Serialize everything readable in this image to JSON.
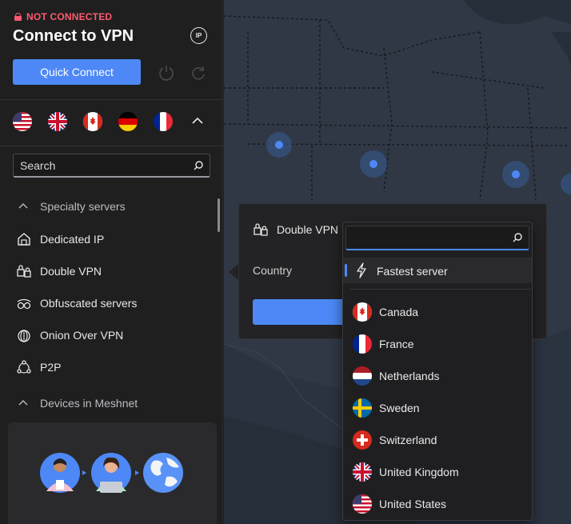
{
  "sidebar": {
    "status": "NOT CONNECTED",
    "title": "Connect to VPN",
    "ip_label": "IP",
    "quick_connect": "Quick Connect",
    "recent_flags": [
      "us-flag-icon",
      "uk-flag-icon",
      "ca-flag-icon",
      "de-flag-icon",
      "fr-flag-icon"
    ],
    "search_placeholder": "Search",
    "items": [
      {
        "label": "Specialty servers",
        "icon": "chevron-up-icon"
      },
      {
        "label": "Dedicated IP",
        "icon": "house-icon"
      },
      {
        "label": "Double VPN",
        "icon": "double-lock-icon"
      },
      {
        "label": "Obfuscated servers",
        "icon": "glasses-icon"
      },
      {
        "label": "Onion Over VPN",
        "icon": "onion-icon"
      },
      {
        "label": "P2P",
        "icon": "p2p-icon"
      },
      {
        "label": "Devices in Meshnet",
        "icon": "chevron-up-icon"
      }
    ]
  },
  "popover": {
    "title": "Double VPN",
    "country_label": "Country"
  },
  "dropdown": {
    "search_value": "",
    "fastest": "Fastest server",
    "countries": [
      "Canada",
      "France",
      "Netherlands",
      "Sweden",
      "Switzerland",
      "United Kingdom",
      "United States"
    ]
  },
  "colors": {
    "accent": "#4d88f6",
    "status_red": "#ff5a6e"
  }
}
